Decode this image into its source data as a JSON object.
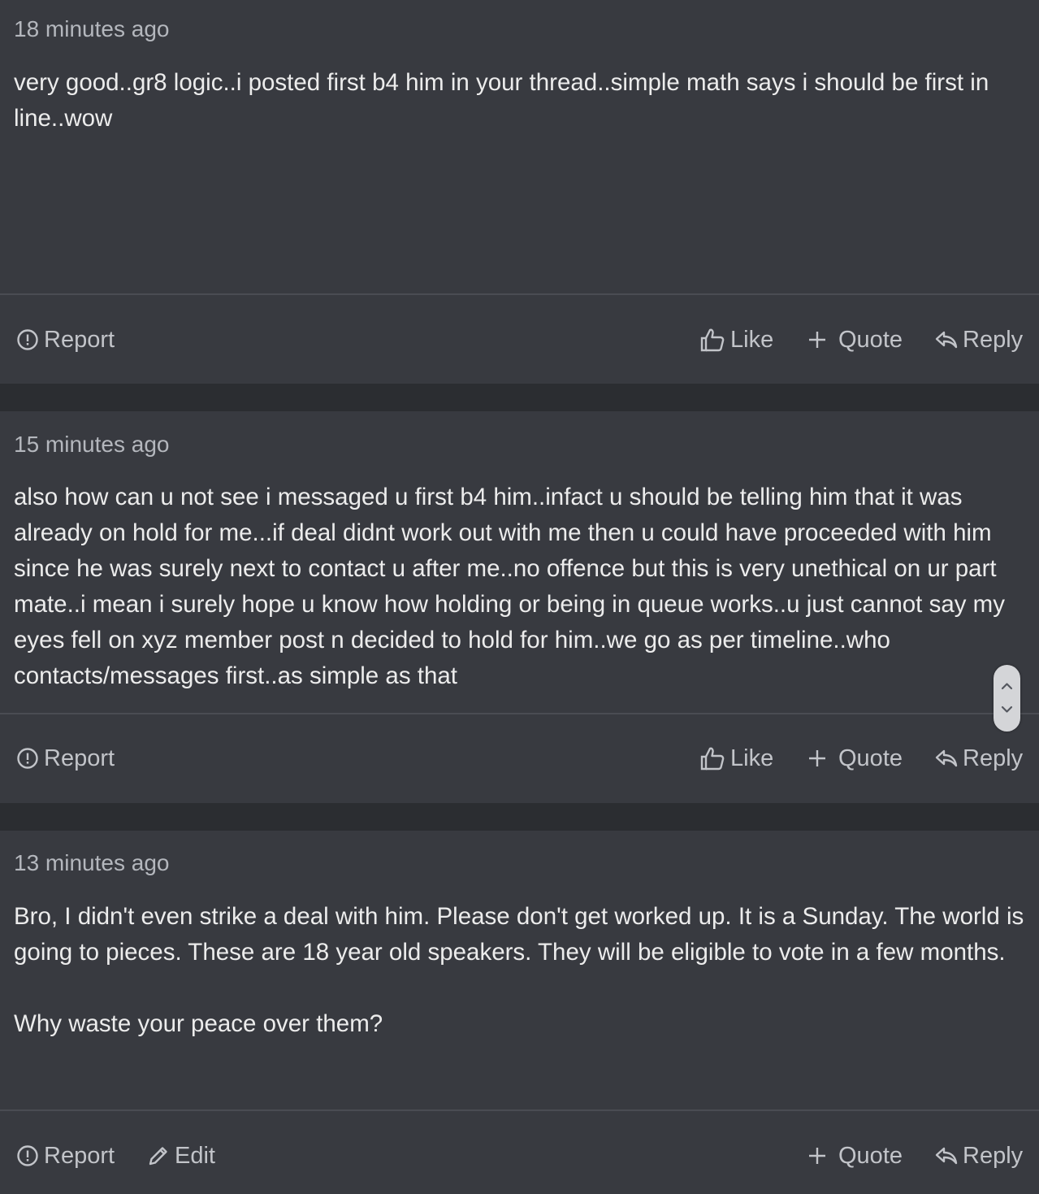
{
  "posts": [
    {
      "time": "18 minutes ago",
      "body": "very good..gr8 logic..i posted first b4 him in your thread..simple math says i should be first in line..wow",
      "actions": {
        "report": "Report",
        "like": "Like",
        "quote": "Quote",
        "reply": "Reply"
      }
    },
    {
      "time": "15 minutes ago",
      "body": "also how can u not see i messaged u first b4 him..infact u should be telling him that it was already on hold for me...if deal didnt work out with me then u could have proceeded with him since he was surely next to contact u after me..no offence but this is very unethical on ur part mate..i mean i surely hope u know how holding or being in queue works..u just cannot say my eyes fell on xyz member post n decided to hold for him..we go as per timeline..who contacts/messages first..as simple as that",
      "actions": {
        "report": "Report",
        "like": "Like",
        "quote": "Quote",
        "reply": "Reply"
      }
    },
    {
      "time": "13 minutes ago",
      "body": "Bro, I didn't even strike a deal with him. Please don't get worked up. It is a Sunday. The world is going to pieces. These are 18 year old speakers. They will be eligible to vote in a few months.\n\nWhy waste your peace over them?",
      "actions": {
        "report": "Report",
        "edit": "Edit",
        "quote": "Quote",
        "reply": "Reply"
      }
    }
  ],
  "colors": {
    "page_bg": "#2b2d31",
    "card_bg": "#383a40",
    "text": "#ececec",
    "muted": "#b4b7bd"
  },
  "icons": [
    "report-icon",
    "like-icon",
    "quote-icon",
    "reply-icon",
    "edit-icon",
    "chevron-up-icon",
    "chevron-down-icon"
  ]
}
